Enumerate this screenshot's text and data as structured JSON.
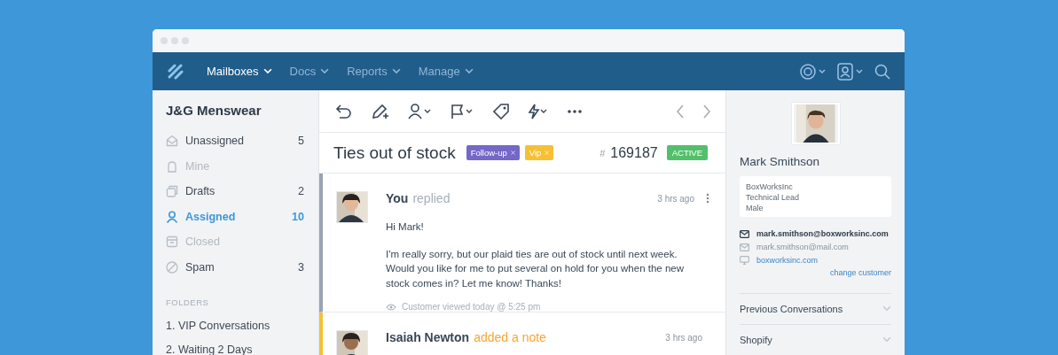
{
  "nav": {
    "items": [
      {
        "label": "Mailboxes",
        "selected": true
      },
      {
        "label": "Docs",
        "selected": false
      },
      {
        "label": "Reports",
        "selected": false
      },
      {
        "label": "Manage",
        "selected": false
      }
    ]
  },
  "sidebar": {
    "title": "J&G Menswear",
    "items": [
      {
        "label": "Unassigned",
        "count": "5",
        "selected": false,
        "disabled": false
      },
      {
        "label": "Mine",
        "selected": false,
        "disabled": true
      },
      {
        "label": "Drafts",
        "count": "2",
        "selected": false,
        "disabled": false
      },
      {
        "label": "Assigned",
        "count": "10",
        "selected": true,
        "disabled": false
      },
      {
        "label": "Closed",
        "selected": false,
        "disabled": true
      },
      {
        "label": "Spam",
        "count": "3",
        "selected": false,
        "disabled": false
      }
    ],
    "folders_heading": "FOLDERS",
    "folders": [
      "1. VIP Conversations",
      "2. Waiting 2 Days"
    ]
  },
  "conversation": {
    "subject": "Ties out of stock",
    "tags": [
      {
        "label": "Follow-up",
        "color": "#7467c8"
      },
      {
        "label": "Vip",
        "color": "#f7c033"
      }
    ],
    "hash": "#",
    "number": "169187",
    "status": "ACTIVE"
  },
  "threads": [
    {
      "kind": "reply",
      "author": "You",
      "action": "replied",
      "time": "3 hrs ago",
      "greeting": "Hi Mark!",
      "body": "I'm really sorry, but our plaid ties are out of stock until next week. Would you like for me to put several on hold for you when the new stock comes in? Let me know! Thanks!",
      "viewed": "Customer viewed today @ 5:25 pm"
    },
    {
      "kind": "note",
      "author": "Isaiah Newton",
      "action": "added a note",
      "time": "3 hrs ago"
    }
  ],
  "customer": {
    "name": "Mark Smithson",
    "details": [
      "BoxWorksInc",
      "Technical Lead",
      "Male"
    ],
    "contacts": [
      {
        "kind": "primary-email",
        "text": "mark.smithson@boxworksinc.com"
      },
      {
        "kind": "email",
        "text": "mark.smithson@mail.com"
      },
      {
        "kind": "website",
        "text": "boxworksinc.com"
      }
    ],
    "change": "change customer",
    "sections": [
      "Previous Conversations",
      "Shopify"
    ]
  }
}
